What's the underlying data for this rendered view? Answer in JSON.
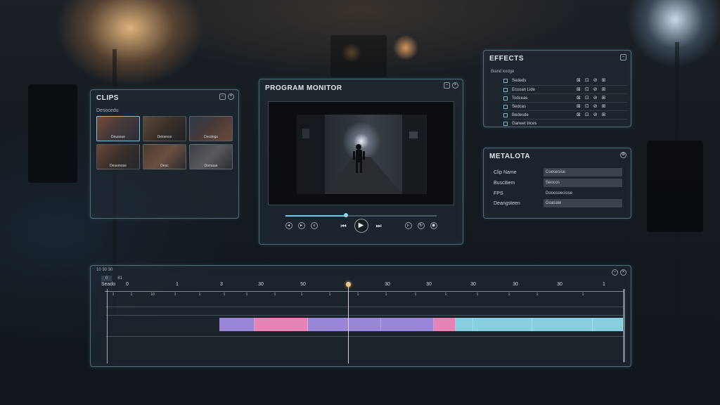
{
  "clips_panel": {
    "title": "CLIPS",
    "subtitle": "Desocedu",
    "thumbs": [
      {
        "label": "Deuasue",
        "selected": true
      },
      {
        "label": "Deioevse",
        "selected": false
      },
      {
        "label": "Decdogs",
        "selected": false
      },
      {
        "label": "Desemose",
        "selected": false
      },
      {
        "label": "Desc",
        "selected": false
      },
      {
        "label": "Domaue",
        "selected": false
      }
    ]
  },
  "monitor_panel": {
    "title": "PROGRAM MONITOR",
    "playback_progress": 0.4
  },
  "effects_panel": {
    "title": "EFFECTS",
    "subtitle": "Biand kodge",
    "items": [
      "Sededs",
      "Eccoan Lide",
      "Todceas",
      "Sedcas",
      "Bedesde",
      "Ganeet bices"
    ],
    "tool_glyphs": [
      "⊠",
      "⊡",
      "⊘",
      "⊞"
    ]
  },
  "metadata_panel": {
    "title": "METALOTA",
    "rows": [
      {
        "key": "Clip Name",
        "value": "Coesesise",
        "boxed": true
      },
      {
        "key": "Buscitiem",
        "value": "Seocos",
        "boxed": true
      },
      {
        "key": "FPS",
        "value": "Dooosoeciose",
        "boxed": false
      },
      {
        "key": "Deangsteen",
        "value": "Goasaie",
        "boxed": true
      }
    ]
  },
  "timeline_panel": {
    "header": "10 30 30",
    "tabs": [
      "0",
      "81"
    ],
    "ruler_major": [
      "Seado",
      "0",
      "1",
      "3",
      "30",
      "50",
      "3",
      "30",
      "30",
      "30",
      "30",
      "30",
      "1"
    ],
    "ruler_minor": [
      "1",
      "1",
      "10",
      "1",
      "1",
      "1",
      "1",
      "1",
      "1",
      "1",
      "1",
      "1",
      "1",
      "1",
      "1",
      "1",
      "1",
      "1"
    ],
    "colors": {
      "purple": "#9a86d6",
      "pink": "#e484b4",
      "cyan": "#86cfe0",
      "playhead": "#f1c88a"
    }
  }
}
